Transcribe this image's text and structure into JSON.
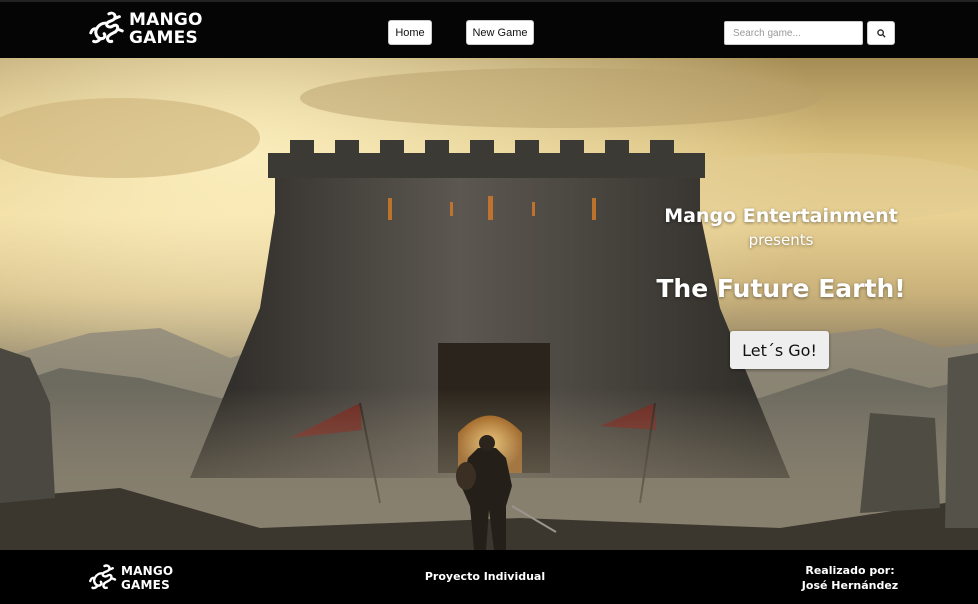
{
  "header": {
    "logo": {
      "line1": "MANGO",
      "line2": "GAMES"
    },
    "nav": {
      "home_label": "Home",
      "new_game_label": "New Game"
    },
    "search": {
      "placeholder": "Search game...",
      "button_icon": "search-icon"
    }
  },
  "hero": {
    "presenter": "Mango Entertainment",
    "presents": "presents",
    "title": "The Future Earth!",
    "cta_label": "Let´s Go!"
  },
  "footer": {
    "logo": {
      "line1": "MANGO",
      "line2": "GAMES"
    },
    "center_text": "Proyecto Individual",
    "credit_label": "Realizado por:",
    "credit_name": "José Hernández"
  }
}
